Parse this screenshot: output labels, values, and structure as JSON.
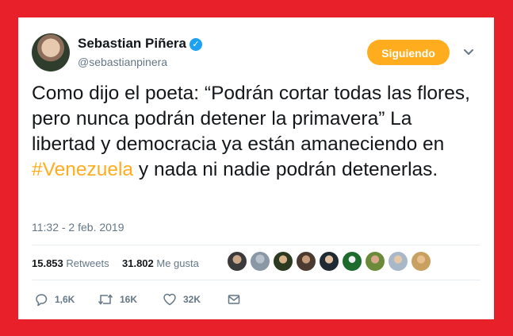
{
  "tweet": {
    "author": {
      "display_name": "Sebastian Piñera",
      "handle": "@sebastianpinera",
      "verified_icon": "verified-badge-icon"
    },
    "follow_button_label": "Siguiendo",
    "text_before": "Como dijo el poeta: “Podrán cortar todas las flores, pero nunca podrán detener la primavera” La libertad y democracia ya están amaneciendo en ",
    "hashtag": "#Venezuela",
    "text_after": " y nada ni nadie podrán detenerlas.",
    "timestamp": "11:32 - 2 feb. 2019",
    "stats": {
      "retweets_count": "15.853",
      "retweets_label": "Retweets",
      "likes_count": "31.802",
      "likes_label": "Me gusta"
    },
    "actions": {
      "reply_count": "1,6K",
      "retweet_count": "16K",
      "like_count": "32K"
    }
  },
  "colors": {
    "background": "#e8202a",
    "accent": "#ffad1f",
    "verified": "#1da1f2",
    "text": "#14171a",
    "muted": "#657786"
  }
}
